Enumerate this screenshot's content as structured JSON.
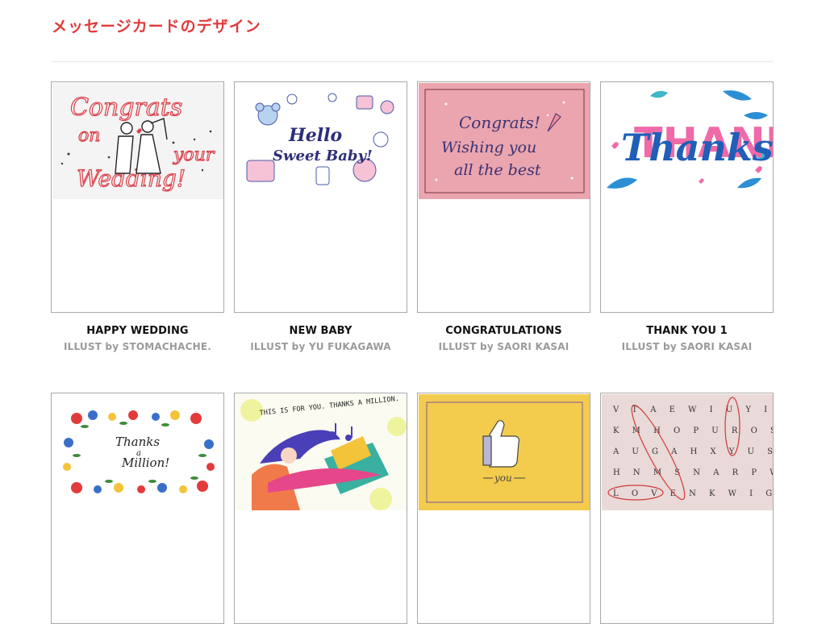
{
  "page": {
    "title": "メッセージカードのデザイン"
  },
  "accent_color": "#e03a3a",
  "cards": [
    {
      "title": "HAPPY WEDDING",
      "credit": "ILLUST by STOMACHACHE.",
      "art_text": [
        "Congrats",
        "on",
        "your",
        "Wedding!"
      ]
    },
    {
      "title": "NEW BABY",
      "credit": "ILLUST by YU FUKAGAWA",
      "art_text": [
        "Hello",
        "Sweet Baby!"
      ]
    },
    {
      "title": "CONGRATULATIONS",
      "credit": "ILLUST by SAORI KASAI",
      "art_text": [
        "Congrats!",
        "Wishing you",
        "all the best"
      ]
    },
    {
      "title": "THANK YOU 1",
      "credit": "ILLUST by SAORI KASAI",
      "art_text": [
        "THANK",
        "Thanks"
      ]
    },
    {
      "title": "",
      "credit": "",
      "art_text": [
        "Thanks",
        "a",
        "Million!"
      ]
    },
    {
      "title": "",
      "credit": "",
      "art_text": [
        "THIS IS FOR YOU. THANKS A MILLION."
      ]
    },
    {
      "title": "",
      "credit": "",
      "art_text": [
        "you"
      ]
    },
    {
      "title": "",
      "credit": "",
      "art_text": [
        "V T A E W I U Y I S",
        "K M H O P U R O S Q",
        "A U G A H X Y U S Z",
        "H N M S N A R P W K",
        "L O V E N K W I G Y"
      ]
    }
  ]
}
